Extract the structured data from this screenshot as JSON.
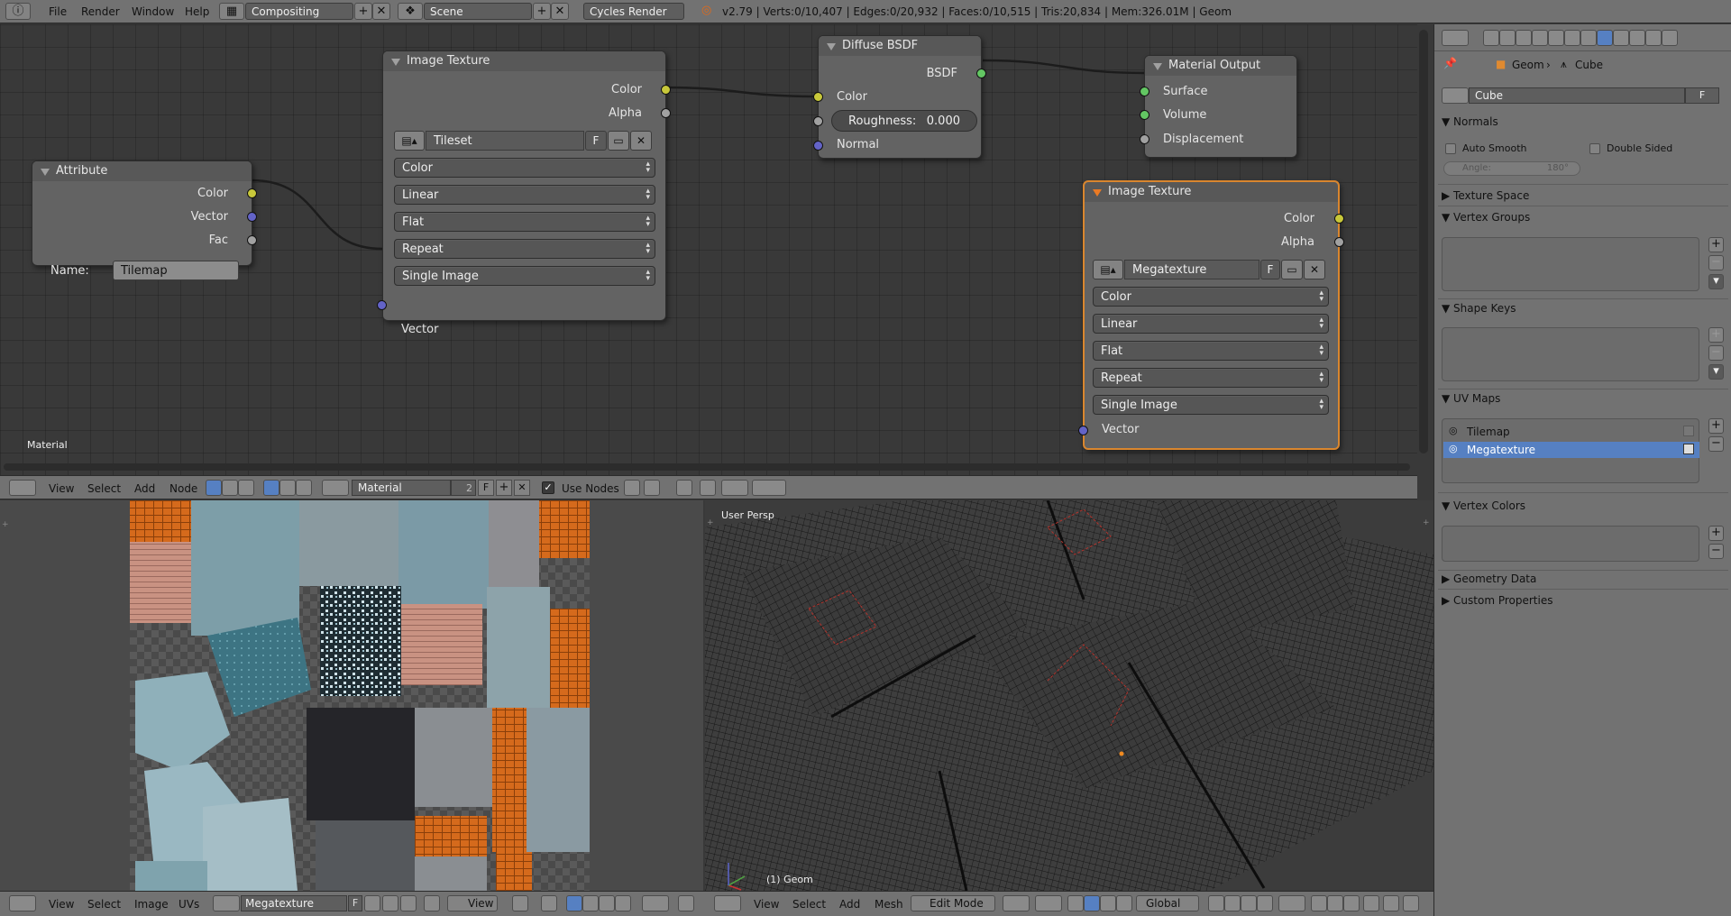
{
  "topbar": {
    "menus": [
      "File",
      "Render",
      "Window",
      "Help"
    ],
    "screen": "Compositing",
    "scene": "Scene",
    "engine": "Cycles Render",
    "stats": "v2.79 | Verts:0/10,407 | Edges:0/20,932 | Faces:0/10,515 | Tris:20,834 | Mem:326.01M | Geom"
  },
  "node_editor": {
    "label": "Material",
    "nodes": {
      "attribute": {
        "title": "Attribute",
        "out_color": "Color",
        "out_vector": "Vector",
        "out_fac": "Fac",
        "name_label": "Name:",
        "name_value": "Tilemap"
      },
      "image1": {
        "title": "Image Texture",
        "out_color": "Color",
        "out_alpha": "Alpha",
        "image": "Tileset",
        "fake": "F",
        "color_space": "Color",
        "interpolation": "Linear",
        "projection": "Flat",
        "extension": "Repeat",
        "source": "Single Image",
        "in_vector": "Vector"
      },
      "diffuse": {
        "title": "Diffuse BSDF",
        "out_bsdf": "BSDF",
        "in_color": "Color",
        "roughness_label": "Roughness:",
        "roughness_value": "0.000",
        "in_normal": "Normal"
      },
      "output": {
        "title": "Material Output",
        "in_surface": "Surface",
        "in_volume": "Volume",
        "in_displacement": "Displacement"
      },
      "image2": {
        "title": "Image Texture",
        "out_color": "Color",
        "out_alpha": "Alpha",
        "image": "Megatexture",
        "fake": "F",
        "color_space": "Color",
        "interpolation": "Linear",
        "projection": "Flat",
        "extension": "Repeat",
        "source": "Single Image",
        "in_vector": "Vector"
      }
    }
  },
  "node_header": {
    "menus": [
      "View",
      "Select",
      "Add",
      "Node"
    ],
    "material": "Material",
    "users": "2",
    "fake": "F",
    "use_nodes_label": "Use Nodes",
    "use_nodes_checked": true
  },
  "uv_editor": {
    "menus": [
      "View",
      "Select",
      "Image",
      "UVs"
    ],
    "image": "Megatexture",
    "fake": "F",
    "view_mode": "View"
  },
  "viewport": {
    "label": "User Persp",
    "object_label": "(1) Geom",
    "menus": [
      "View",
      "Select",
      "Add",
      "Mesh"
    ],
    "mode": "Edit Mode",
    "orientation": "Global"
  },
  "properties": {
    "breadcrumb_object": "Geom",
    "breadcrumb_mesh": "Cube",
    "mesh_name": "Cube",
    "fake": "F",
    "normals": {
      "title": "Normals",
      "auto_smooth": "Auto Smooth",
      "double_sided": "Double Sided",
      "angle_label": "Angle:",
      "angle_value": "180°"
    },
    "texture_space": "Texture Space",
    "vertex_groups": "Vertex Groups",
    "shape_keys": "Shape Keys",
    "uv_maps": {
      "title": "UV Maps",
      "items": [
        "Tilemap",
        "Megatexture"
      ],
      "active": 1
    },
    "vertex_colors": "Vertex Colors",
    "geometry_data": "Geometry Data",
    "custom_properties": "Custom Properties"
  },
  "colors": {
    "selection_outline": "#d9862e",
    "active_item": "#5680c2",
    "socket_yellow": "#c8c83a",
    "socket_purple": "#6363c7",
    "socket_green": "#63c763"
  }
}
